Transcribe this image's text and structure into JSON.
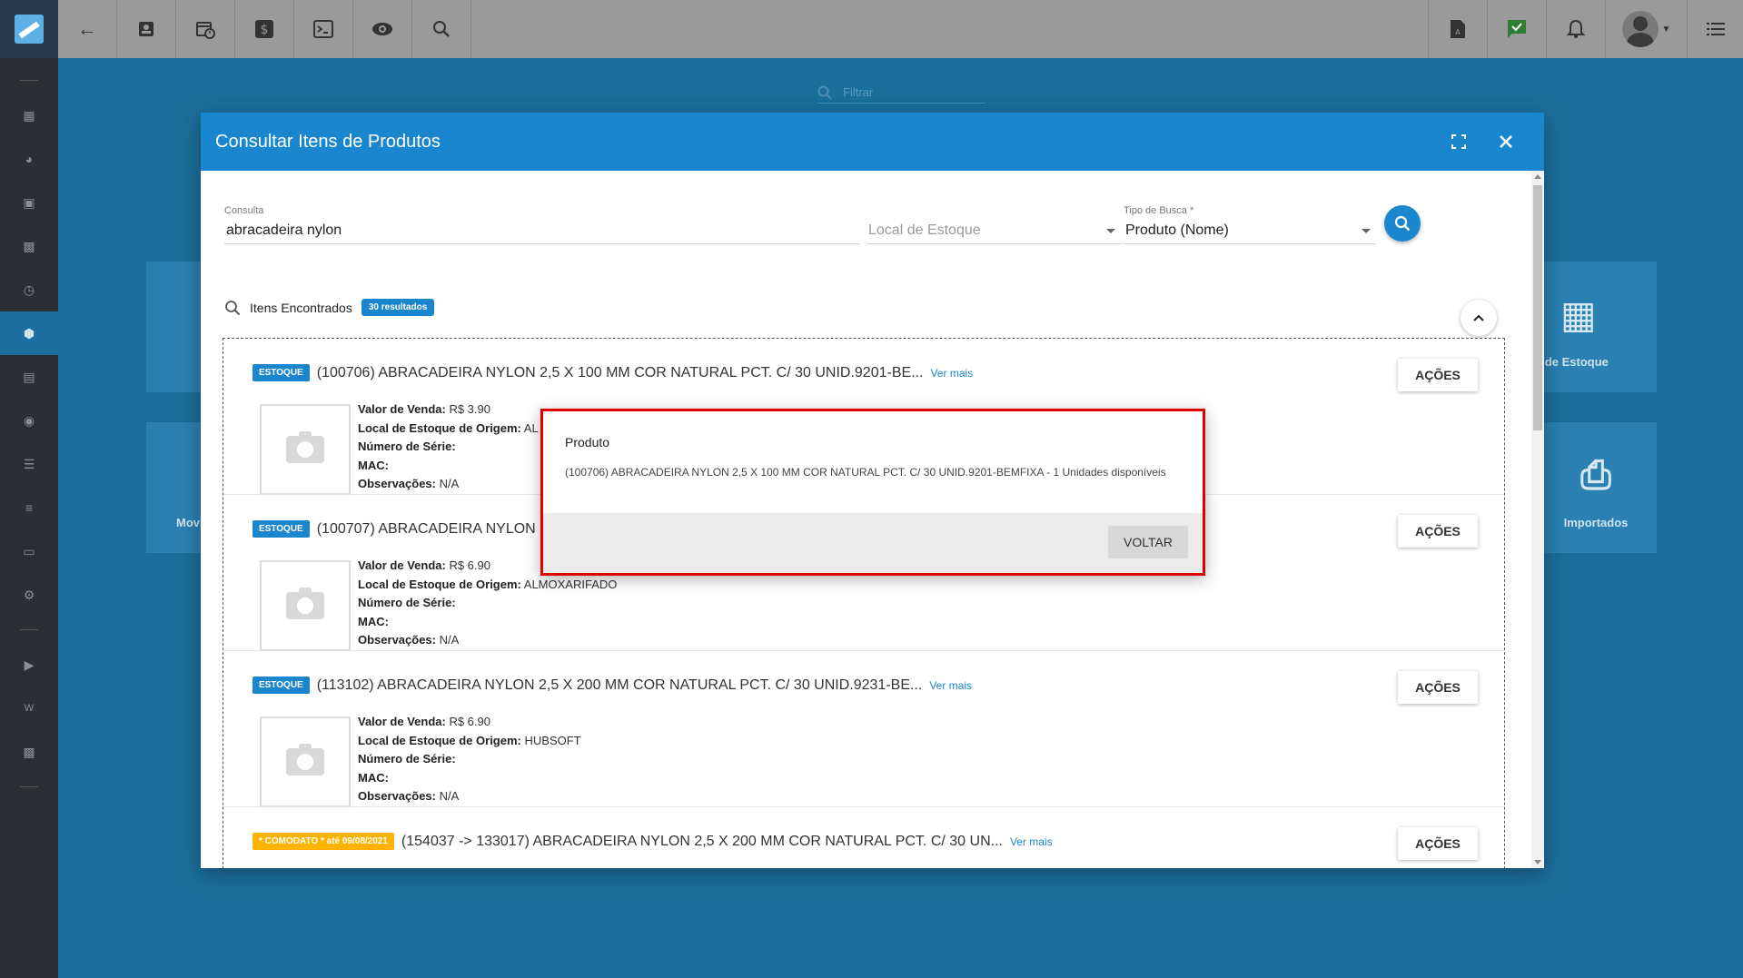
{
  "topbar": {
    "left_icons": [
      "back-arrow-icon",
      "contact-card-icon",
      "calendar-clock-icon",
      "dollar-icon",
      "terminal-icon",
      "eye-icon",
      "search-icon"
    ],
    "right_icons": [
      "pdf-document-icon",
      "check-message-icon",
      "bell-icon"
    ]
  },
  "sidebar": {
    "icons": [
      "dashboard-icon",
      "pie-chart-icon",
      "contacts-icon",
      "book-icon",
      "schedule-icon",
      "box-icon",
      "money-icon",
      "location-icon",
      "list-icon",
      "server-icon",
      "document-icon",
      "gear-icon",
      "video-icon",
      "wiki-icon",
      "chat-icon"
    ]
  },
  "background": {
    "filter_placeholder": "Filtrar",
    "cards": [
      {
        "label": "s de Estoque",
        "icon": "building-icon"
      },
      {
        "label": "Importados",
        "icon": "code-file-icon"
      },
      {
        "label": "Movi",
        "icon": ""
      }
    ]
  },
  "modal": {
    "title": "Consultar Itens de Produtos",
    "consulta_label": "Consulta",
    "consulta_value": "abracadeira nylon",
    "local_placeholder": "Local de Estoque",
    "tipo_label": "Tipo de Busca *",
    "tipo_value": "Produto (Nome)",
    "found_label": "Itens Encontrados",
    "found_badge": "30 resultados",
    "acoes_label": "AÇÕES",
    "ver_mais": "Ver mais",
    "labels": {
      "valor": "Valor de Venda:",
      "local": "Local de Estoque de Origem:",
      "serie": "Número de Série:",
      "mac": "MAC:",
      "obs": "Observações:"
    },
    "items": [
      {
        "tag": "ESTOQUE",
        "title": "(100706) ABRACADEIRA NYLON 2,5 X 100 MM COR NATURAL PCT. C/ 30 UNID.9201-BE...",
        "valor": "R$ 3.90",
        "local": "AL",
        "obs": "N/A"
      },
      {
        "tag": "ESTOQUE",
        "title": "(100707) ABRACADEIRA NYLON 2",
        "valor": "R$ 6.90",
        "local": "ALMOXARIFADO",
        "obs": "N/A"
      },
      {
        "tag": "ESTOQUE",
        "title": "(113102) ABRACADEIRA NYLON 2,5 X 200 MM COR NATURAL PCT. C/ 30 UNID.9231-BE...",
        "valor": "R$ 6.90",
        "local": "HUBSOFT",
        "obs": "N/A"
      },
      {
        "tag": "* COMODATO * até 09/08/2021",
        "title": "(154037 -> 133017) ABRACADEIRA NYLON 2,5 X 200 MM COR NATURAL PCT. C/ 30 UN..."
      }
    ]
  },
  "popup": {
    "title": "Produto",
    "text": "(100706) ABRACADEIRA NYLON 2,5 X 100 MM COR NATURAL PCT. C/ 30 UNID.9201-BEMFIXA - 1 Unidades disponíveis",
    "button": "VOLTAR"
  }
}
